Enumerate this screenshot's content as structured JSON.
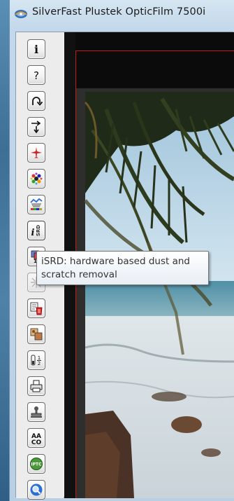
{
  "window": {
    "title": "SilverFast Plustek OpticFilm 7500i"
  },
  "toolbar": {
    "buttons": [
      {
        "name": "info-button",
        "icon": "info-icon"
      },
      {
        "name": "help-button",
        "icon": "question-icon"
      },
      {
        "name": "reset-button",
        "icon": "curved-arrow-icon"
      },
      {
        "name": "batch-button",
        "icon": "arrows-icon"
      },
      {
        "name": "airplane-button",
        "icon": "airplane-icon"
      },
      {
        "name": "color-button",
        "icon": "color-wheel-icon"
      },
      {
        "name": "histogram-button",
        "icon": "histogram-icon"
      },
      {
        "name": "isrd-button",
        "icon": "isrd-icon",
        "label": "iSRD"
      },
      {
        "name": "multi-exposure-button",
        "icon": "multi-icon"
      },
      {
        "name": "sharpen-button",
        "icon": "sparkle-icon"
      },
      {
        "name": "delete-button",
        "icon": "trash-icon"
      },
      {
        "name": "frames-button",
        "icon": "frames-icon"
      },
      {
        "name": "scale-button",
        "icon": "fraction-icon"
      },
      {
        "name": "print-button",
        "icon": "printer-icon"
      },
      {
        "name": "stamp-button",
        "icon": "stamp-icon"
      },
      {
        "name": "text-button",
        "icon": "aa-icon",
        "label": "AA"
      },
      {
        "name": "iptc-button",
        "icon": "iptc-icon",
        "label": "IPTC"
      },
      {
        "name": "zoom-button",
        "icon": "magnifier-icon"
      }
    ]
  },
  "tooltip": {
    "line1": "iSRD: hardware based dust and",
    "line2": "scratch removal"
  },
  "colors": {
    "frame_border": "#c21818",
    "accent": "#2b6fd1"
  }
}
